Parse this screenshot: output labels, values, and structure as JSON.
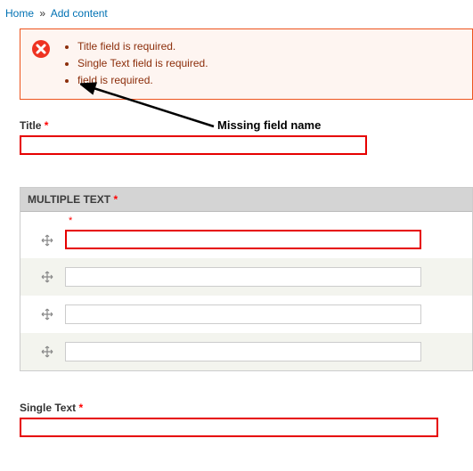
{
  "breadcrumb": {
    "home": "Home",
    "sep": "»",
    "add_content": "Add content"
  },
  "messages": {
    "items": [
      "Title field is required.",
      "Single Text field is required.",
      "field is required."
    ]
  },
  "annotation": "Missing field name",
  "title_field": {
    "label": "Title",
    "required": "*",
    "value": ""
  },
  "multiple": {
    "header": "MULTIPLE TEXT",
    "required": "*",
    "rows": [
      {
        "label_required": "*",
        "value": ""
      },
      {
        "label_required": "",
        "value": ""
      },
      {
        "label_required": "",
        "value": ""
      },
      {
        "label_required": "",
        "value": ""
      }
    ]
  },
  "single_text": {
    "label": "Single Text",
    "required": "*",
    "value": ""
  }
}
